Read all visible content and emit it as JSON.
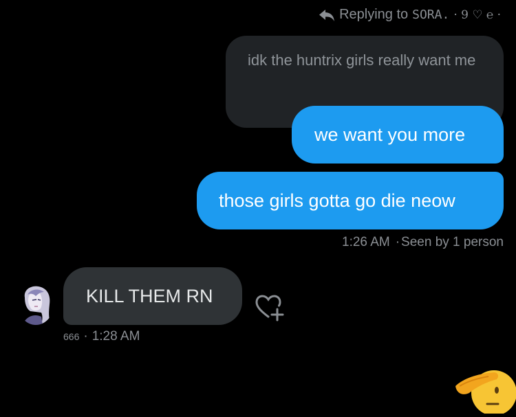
{
  "reply_header": {
    "label": "Replying to",
    "name": "SORA.",
    "suffix": "· 9 ♡ ℮ ·"
  },
  "quoted_message": {
    "text": "idk the huntrix girls really want me"
  },
  "outgoing_messages": [
    {
      "text": "we want you more"
    },
    {
      "text": "those girls gotta go die neow"
    }
  ],
  "outgoing_meta": {
    "time": "1:26 AM",
    "seen": "Seen by 1 person"
  },
  "incoming_message": {
    "text": "KILL THEM RN",
    "count": "666",
    "time": "1:28 AM"
  },
  "icons": {
    "reply": "reply-arrow-icon",
    "react": "add-reaction-heart-icon",
    "emoji": "saluting-face-emoji"
  },
  "colors": {
    "background": "#000000",
    "outgoing_bubble": "#1d9bf0",
    "incoming_bubble": "#2f3336",
    "quoted_bubble": "#202326",
    "meta_text": "#8b8f94"
  }
}
